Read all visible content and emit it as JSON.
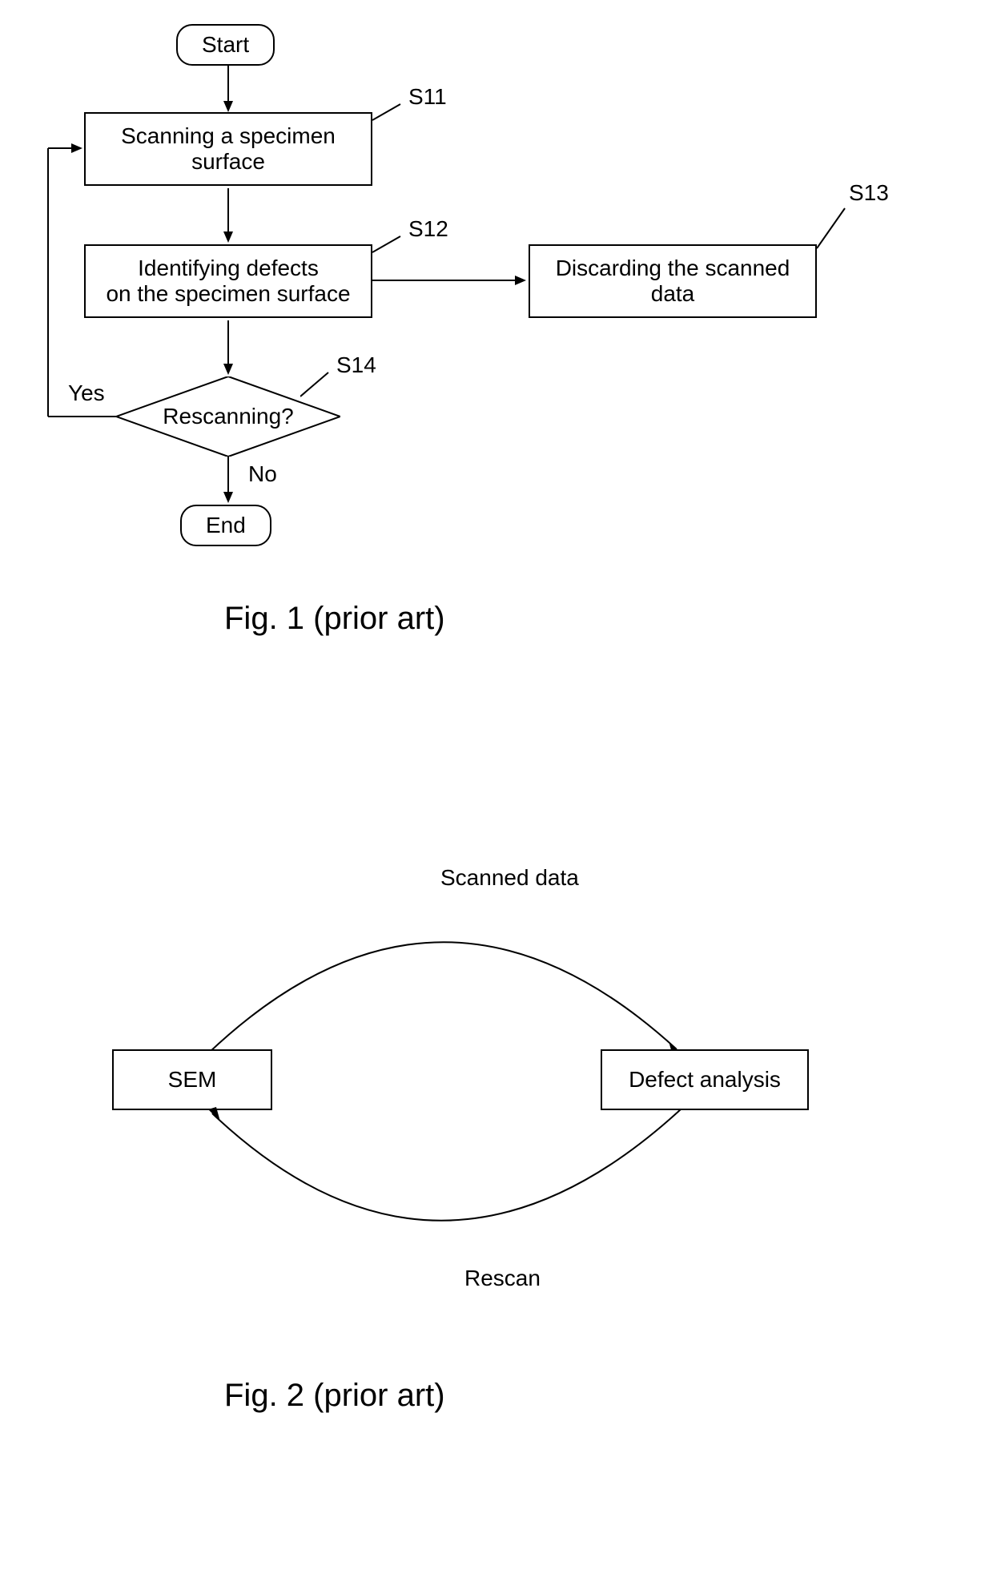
{
  "fig1": {
    "start": "Start",
    "s11_text": "Scanning a specimen\nsurface",
    "s11_label": "S11",
    "s12_text": "Identifying defects\non the specimen surface",
    "s12_label": "S12",
    "s13_text": "Discarding the scanned\ndata",
    "s13_label": "S13",
    "s14_text": "Rescanning?",
    "s14_label": "S14",
    "yes": "Yes",
    "no": "No",
    "end": "End",
    "caption": "Fig. 1 (prior art)"
  },
  "fig2": {
    "sem": "SEM",
    "defect": "Defect analysis",
    "scanned": "Scanned data",
    "rescan": "Rescan",
    "caption": "Fig. 2 (prior art)"
  }
}
